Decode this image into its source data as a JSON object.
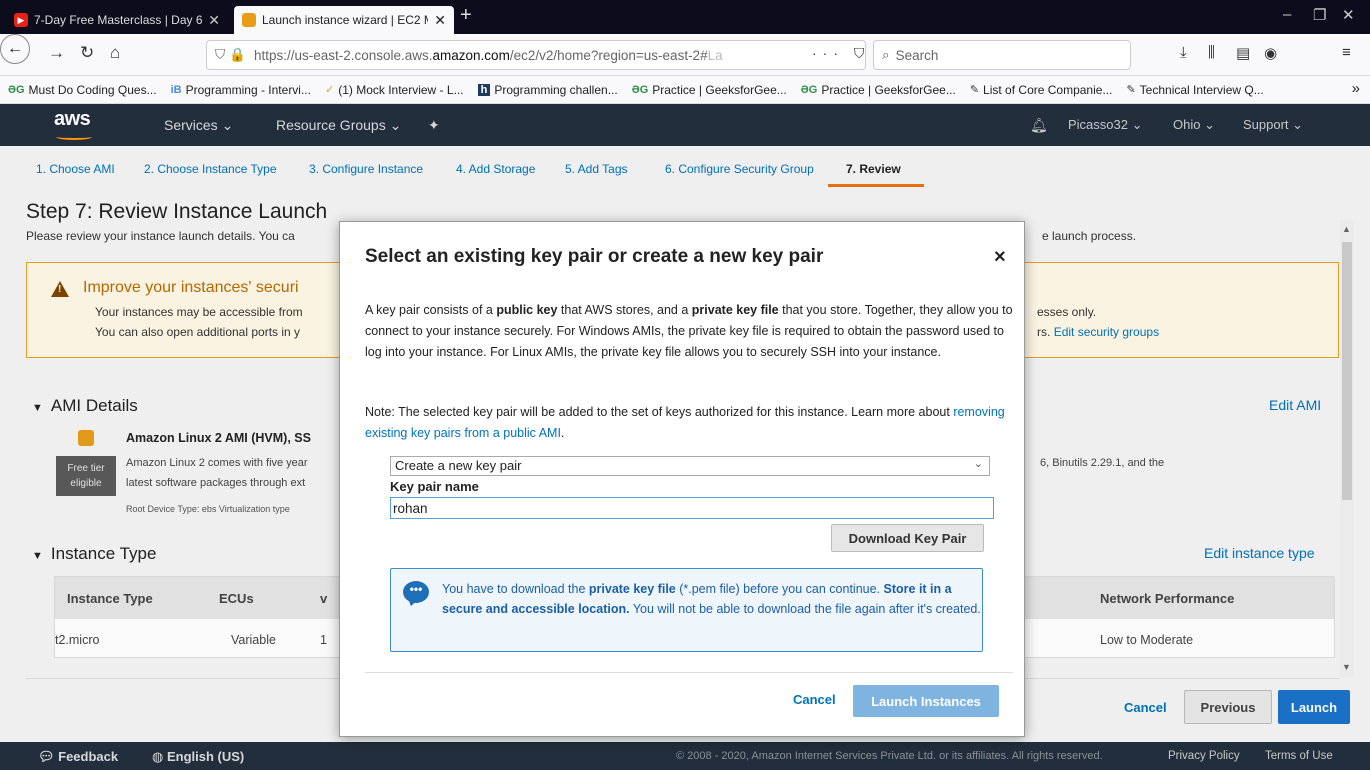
{
  "browser": {
    "tabs": [
      {
        "title": "7-Day Free Masterclass | Day 6",
        "active": false
      },
      {
        "title": "Launch instance wizard | EC2 M",
        "active": true
      }
    ],
    "new_tab": "+",
    "url": {
      "prefix": "https://us-east-2.console.aws.",
      "host": "amazon.com",
      "path": "/ec2/v2/home?region=us-east-2#",
      "fade": "La"
    },
    "url_actions": "··· ⛉ ☆",
    "search_placeholder": "Search",
    "bookmarks": [
      {
        "icon": "ƏG",
        "label": "Must Do Coding Ques..."
      },
      {
        "icon": "iB",
        "label": "Programming - Intervi..."
      },
      {
        "icon": "✓",
        "label": "(1) Mock Interview - L..."
      },
      {
        "icon": "h",
        "label": "Programming challen..."
      },
      {
        "icon": "ƏG",
        "label": "Practice | GeeksforGee..."
      },
      {
        "icon": "ƏG",
        "label": "Practice | GeeksforGee..."
      },
      {
        "icon": "✎",
        "label": "List of Core Companie..."
      },
      {
        "icon": "✎",
        "label": "Technical Interview Q..."
      }
    ],
    "bookmarks_more": "»"
  },
  "aws_header": {
    "logo": "aws",
    "services": "Services ⌄",
    "resource_groups": "Resource Groups ⌄",
    "pin": "✦",
    "bell": "🔔",
    "user": "Picasso32 ⌄",
    "region": "Ohio ⌄",
    "support": "Support ⌄"
  },
  "wizard_steps": [
    "1. Choose AMI",
    "2. Choose Instance Type",
    "3. Configure Instance",
    "4. Add Storage",
    "5. Add Tags",
    "6. Configure Security Group",
    "7. Review"
  ],
  "page": {
    "title": "Step 7: Review Instance Launch",
    "subtitle": "Please review your instance launch details. You ca",
    "subtitle_tail": "e launch process.",
    "warning": {
      "title": "Improve your instances' securi",
      "line1": "Your instances may be accessible from",
      "line2": "You can also open additional ports in y",
      "line1_tail": "esses only.",
      "line2_tail": "rs.",
      "edit_link": "Edit security groups"
    },
    "ami": {
      "section": "AMI Details",
      "edit": "Edit AMI",
      "name": "Amazon Linux 2 AMI (HVM), SS",
      "free_tier": "Free tier eligible",
      "desc1": "Amazon Linux 2 comes with five year",
      "desc2": "latest software packages through ext",
      "desc1_tail": "6, Binutils 2.29.1, and the",
      "meta": "Root Device Type: ebs   Virtualization type"
    },
    "instance": {
      "section": "Instance Type",
      "edit": "Edit instance type",
      "headers": [
        "Instance Type",
        "ECUs",
        "v",
        "Network Performance"
      ],
      "row": [
        "t2.micro",
        "Variable",
        "1",
        "Low to Moderate"
      ]
    },
    "cancel": "Cancel",
    "previous": "Previous",
    "launch": "Launch"
  },
  "footer": {
    "feedback": "Feedback",
    "language": "English (US)",
    "copyright": "© 2008 - 2020, Amazon Internet Services Private Ltd. or its affiliates. All rights reserved.",
    "privacy": "Privacy Policy",
    "terms": "Terms of Use"
  },
  "modal": {
    "title": "Select an existing key pair or create a new key pair",
    "close": "×",
    "body_html": "A key pair consists of a <b>public key</b> that AWS stores, and a <b>private key file</b> that you store. Together, they allow you to connect to your instance securely. For Windows AMIs, the private key file is required to obtain the password used to log into your instance. For Linux AMIs, the private key file allows you to securely SSH into your instance.",
    "note": "Note: The selected key pair will be added to the set of keys authorized for this instance. Learn more about",
    "note_link": "removing existing key pairs from a public AMI",
    "select_value": "Create a new key pair",
    "key_label": "Key pair name",
    "key_value": "rohan",
    "download": "Download Key Pair",
    "info_html": "You have to download the <b>private key file</b> (*.pem file) before you can continue. <b>Store it in a secure and accessible location.</b> You will not be able to download the file again after it's created.",
    "cancel": "Cancel",
    "launch": "Launch Instances"
  },
  "colors": {
    "aws_nav": "#232f3e",
    "link": "#0073bb",
    "accent_orange": "#ec7211",
    "warning_border": "#eb9f25",
    "launch_button": "#1a73c8",
    "launch_disabled": "#7fb3e0"
  }
}
